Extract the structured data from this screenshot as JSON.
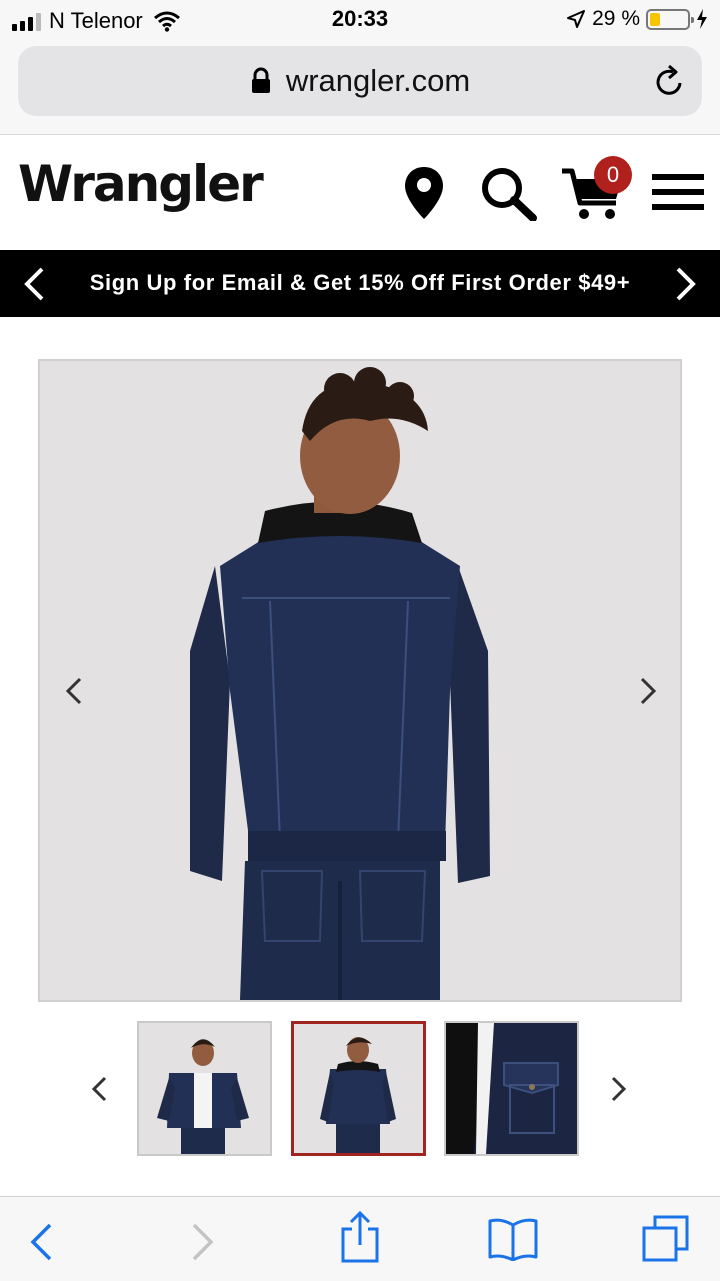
{
  "status_bar": {
    "carrier": "N Telenor",
    "time": "20:33",
    "battery_percent": "29 %",
    "battery_level": 0.29,
    "battery_color": "#f7c500"
  },
  "browser": {
    "url": "wrangler.com",
    "icons": [
      "lock-icon",
      "reload-icon",
      "back-icon",
      "forward-icon",
      "share-icon",
      "bookmarks-icon",
      "tabs-icon"
    ]
  },
  "header": {
    "logo": "Wrangler",
    "cart_count": "0",
    "icons": [
      "location-pin-icon",
      "search-icon",
      "cart-icon",
      "hamburger-menu-icon"
    ],
    "badge_color": "#b0201c"
  },
  "promo": {
    "text": "Sign Up for Email & Get 15% Off First Order $49+"
  },
  "product": {
    "main_image": "model-back-view-denim-sherpa-jacket",
    "thumbnails": [
      {
        "image": "model-front-view-open-jacket",
        "selected": false
      },
      {
        "image": "model-back-view-jacket",
        "selected": true
      },
      {
        "image": "jacket-detail-pocket-closeup",
        "selected": false
      }
    ],
    "selected_color": "#a02420"
  }
}
